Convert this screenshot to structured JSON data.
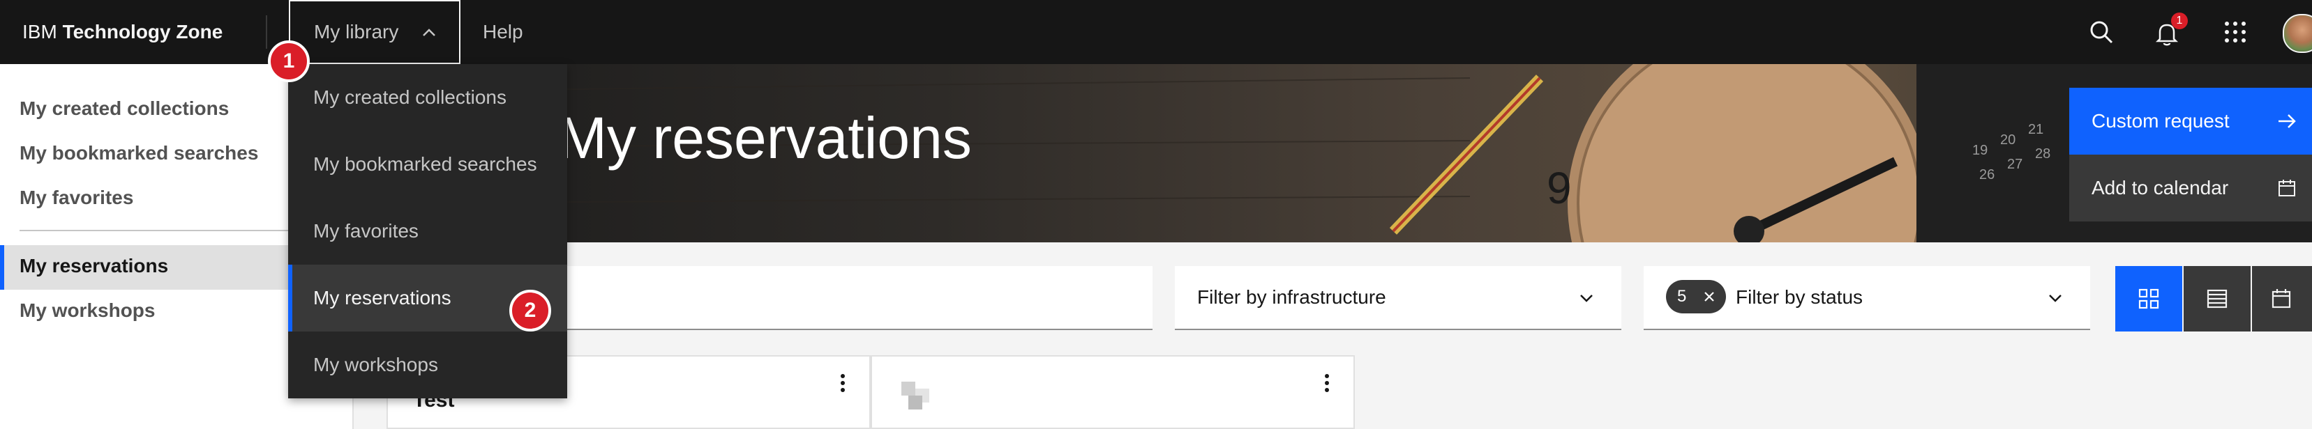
{
  "header": {
    "brand_prefix": "IBM",
    "brand_name": "Technology Zone",
    "my_library_label": "My library",
    "help_label": "Help",
    "notification_count": "1"
  },
  "left_nav": {
    "items": [
      {
        "label": "My created collections"
      },
      {
        "label": "My bookmarked searches"
      },
      {
        "label": "My favorites"
      },
      {
        "label": "My reservations"
      },
      {
        "label": "My workshops"
      }
    ],
    "active": "My reservations"
  },
  "dropdown": {
    "items": [
      {
        "label": "My created collections"
      },
      {
        "label": "My bookmarked searches"
      },
      {
        "label": "My favorites"
      },
      {
        "label": "My reservations"
      },
      {
        "label": "My workshops"
      }
    ],
    "active": "My reservations"
  },
  "hero": {
    "title": "My reservations",
    "custom_request_label": "Custom request",
    "add_to_calendar_label": "Add to calendar"
  },
  "filters": {
    "infrastructure_label": "Filter by infrastructure",
    "status_label": "Filter by status",
    "status_count": "5"
  },
  "cards": [
    {
      "title": "Test"
    }
  ],
  "annotations": {
    "step1": "1",
    "step2": "2"
  },
  "colors": {
    "header_bg": "#161616",
    "accent": "#0f62fe",
    "badge_red": "#da1e28",
    "menu_bg": "#262626"
  },
  "icons": [
    "chevron-up-icon",
    "search-icon",
    "notification-icon",
    "app-switcher-icon",
    "avatar",
    "arrow-right-icon",
    "calendar-icon",
    "chevron-down-icon",
    "close-icon",
    "grid-view-icon",
    "list-view-icon",
    "calendar-view-icon",
    "overflow-menu-icon"
  ]
}
